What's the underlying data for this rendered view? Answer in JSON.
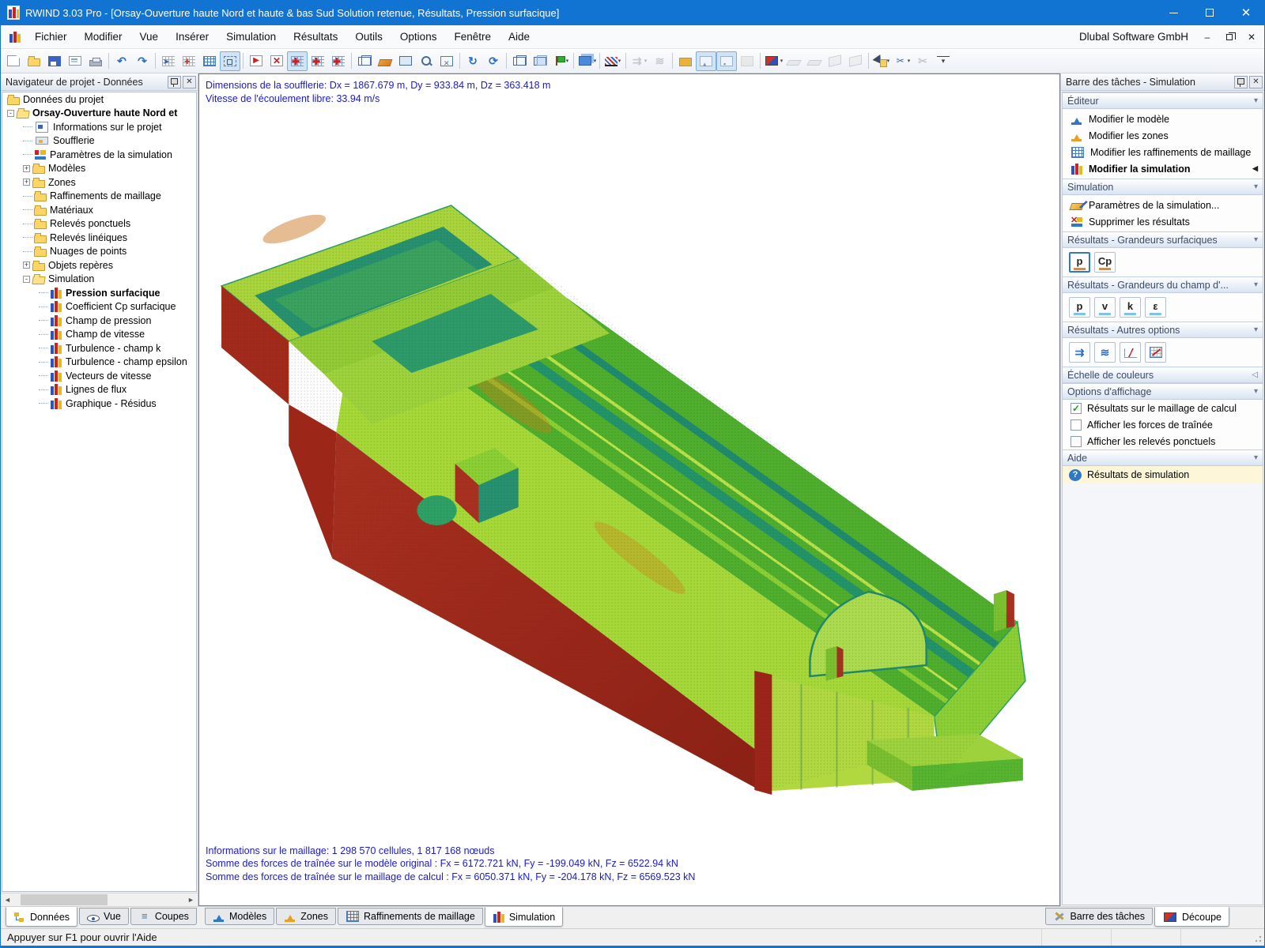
{
  "window": {
    "title": "RWIND 3.03 Pro - [Orsay-Ouverture haute Nord et haute & bas Sud Solution retenue, Résultats, Pression surfacique]"
  },
  "menu": {
    "items": [
      "Fichier",
      "Modifier",
      "Vue",
      "Insérer",
      "Simulation",
      "Résultats",
      "Outils",
      "Options",
      "Fenêtre",
      "Aide"
    ],
    "right_text": "Dlubal Software GmbH"
  },
  "toolbar": {
    "buttons": [
      {
        "name": "new-file",
        "icon": "page"
      },
      {
        "name": "open-file",
        "icon": "folder-open-tb"
      },
      {
        "name": "save",
        "icon": "floppy"
      },
      {
        "name": "print-preview",
        "icon": "preview"
      },
      {
        "name": "print",
        "icon": "printer"
      },
      {
        "sep": true
      },
      {
        "name": "undo",
        "icon": "undo"
      },
      {
        "name": "redo",
        "icon": "redo"
      },
      {
        "sep": true
      },
      {
        "name": "wind-zone",
        "icon": "wind"
      },
      {
        "name": "generate-mesh",
        "icon": "meshnode"
      },
      {
        "name": "mesh-nodes",
        "icon": "grid"
      },
      {
        "name": "mesh-region",
        "icon": "dottedbox",
        "state": "toggled"
      },
      {
        "sep": true
      },
      {
        "name": "run-simulation",
        "icon": "play"
      },
      {
        "name": "stop-simulation",
        "icon": "stopx"
      },
      {
        "name": "results-on-mesh",
        "icon": "axesmesh",
        "state": "toggled"
      },
      {
        "name": "results-on-model",
        "icon": "axesmesh"
      },
      {
        "name": "results-values",
        "icon": "axesmesh"
      },
      {
        "sep": true
      },
      {
        "name": "wireframe-view",
        "icon": "cubewire"
      },
      {
        "name": "rendered-view",
        "icon": "render"
      },
      {
        "name": "select-mode",
        "icon": "selectbox"
      },
      {
        "name": "zoom-window",
        "icon": "magnifier"
      },
      {
        "name": "zoom-fit",
        "icon": "fitview"
      },
      {
        "sep": true
      },
      {
        "name": "rotate-view",
        "icon": "rotate"
      },
      {
        "name": "refresh-view",
        "icon": "refresh"
      },
      {
        "sep": true
      },
      {
        "name": "isometric-view",
        "icon": "cubewire2"
      },
      {
        "name": "projection-mode",
        "icon": "cubeface"
      },
      {
        "name": "display-flags",
        "icon": "flag",
        "dropdown": true
      },
      {
        "sep": true
      },
      {
        "name": "solid-model",
        "icon": "cube3d",
        "dropdown": true
      },
      {
        "sep": true
      },
      {
        "name": "section-hatch",
        "icon": "hatch",
        "dropdown": true
      },
      {
        "sep": true
      },
      {
        "name": "flow-display",
        "icon": "flowarrows",
        "state": "disabled",
        "dropdown": true
      },
      {
        "name": "streamlines-display",
        "icon": "streams",
        "state": "disabled"
      },
      {
        "sep": true
      },
      {
        "name": "clip-new",
        "icon": "clipbox"
      },
      {
        "name": "clip-front",
        "icon": "clipa",
        "state": "toggled"
      },
      {
        "name": "clip-back",
        "icon": "clipb",
        "state": "toggled"
      },
      {
        "name": "clip-paste",
        "icon": "clippaste",
        "state": "disabled"
      },
      {
        "sep": true
      },
      {
        "name": "color-views",
        "icon": "cubergb",
        "dropdown": true
      },
      {
        "name": "clip-plane-a",
        "icon": "slab",
        "state": "disabled"
      },
      {
        "name": "clip-plane-b",
        "icon": "slab2",
        "state": "disabled"
      },
      {
        "name": "clip-plane-c",
        "icon": "plane",
        "state": "disabled"
      },
      {
        "name": "clip-plane-d",
        "icon": "plane2",
        "state": "disabled"
      },
      {
        "sep": true
      },
      {
        "name": "measure",
        "icon": "cursorflag",
        "dropdown": true
      },
      {
        "name": "cut-tools",
        "icon": "cutpen",
        "dropdown": true
      },
      {
        "name": "scissors",
        "icon": "scissors",
        "state": "disabled"
      },
      {
        "name": "toolbar-options",
        "icon": "overflow"
      }
    ]
  },
  "navigator": {
    "title": "Navigateur de projet - Données",
    "tree": [
      {
        "icon": "folder",
        "label": "Données du projet",
        "level": 0
      },
      {
        "icon": "folder-open",
        "label": "Orsay-Ouverture haute Nord et",
        "level": 0,
        "expand": "-",
        "bold": true
      },
      {
        "icon": "doc-info",
        "label": "Informations sur le projet",
        "level": 1
      },
      {
        "icon": "wind-tunnel",
        "label": "Soufflerie",
        "level": 1
      },
      {
        "icon": "sim-params",
        "label": "Paramètres de la simulation",
        "level": 1
      },
      {
        "icon": "folder",
        "label": "Modèles",
        "level": 1,
        "expand": "+"
      },
      {
        "icon": "folder",
        "label": "Zones",
        "level": 1,
        "expand": "+"
      },
      {
        "icon": "folder",
        "label": "Raffinements de maillage",
        "level": 1
      },
      {
        "icon": "folder",
        "label": "Matériaux",
        "level": 1
      },
      {
        "icon": "folder",
        "label": "Relevés ponctuels",
        "level": 1
      },
      {
        "icon": "folder",
        "label": "Relevés linéiques",
        "level": 1
      },
      {
        "icon": "folder",
        "label": "Nuages de points",
        "level": 1
      },
      {
        "icon": "folder",
        "label": "Objets repères",
        "level": 1,
        "expand": "+"
      },
      {
        "icon": "folder-open",
        "label": "Simulation",
        "level": 1,
        "expand": "-"
      },
      {
        "icon": "bars",
        "label": "Pression surfacique",
        "level": 2,
        "bold": true
      },
      {
        "icon": "bars",
        "label": "Coefficient Cp surfacique",
        "level": 2
      },
      {
        "icon": "bars",
        "label": "Champ de pression",
        "level": 2
      },
      {
        "icon": "bars",
        "label": "Champ de vitesse",
        "level": 2
      },
      {
        "icon": "bars",
        "label": "Turbulence - champ k",
        "level": 2
      },
      {
        "icon": "bars",
        "label": "Turbulence - champ epsilon",
        "level": 2
      },
      {
        "icon": "bars",
        "label": "Vecteurs de vitesse",
        "level": 2
      },
      {
        "icon": "bars",
        "label": "Lignes de flux",
        "level": 2
      },
      {
        "icon": "bars",
        "label": "Graphique - Résidus",
        "level": 2
      }
    ]
  },
  "viewport": {
    "info_top": [
      "Dimensions de la soufflerie: Dx = 1867.679 m, Dy = 933.84 m, Dz = 363.418 m",
      "Vitesse de l'écoulement libre: 33.94 m/s"
    ],
    "info_bottom": [
      "Informations sur le maillage: 1 298 570 cellules, 1 817 168 nœuds",
      "Somme des forces de traînée sur le modèle original : Fx = 6172.721 kN, Fy = -199.049 kN, Fz = 6522.94 kN",
      "Somme des forces de traînée sur le maillage de calcul : Fx = 6050.371 kN, Fy = -204.178 kN, Fz = 6569.523 kN"
    ]
  },
  "taskbar": {
    "title": "Barre des tâches - Simulation",
    "sections": [
      {
        "type": "items",
        "label": "Éditeur",
        "items": [
          {
            "icon": "stand-blue",
            "label": "Modifier le modèle"
          },
          {
            "icon": "stand-orange",
            "label": "Modifier les zones"
          },
          {
            "icon": "grid-blue",
            "label": "Modifier les raffinements de maillage"
          },
          {
            "icon": "bars",
            "label": "Modifier la simulation",
            "bold": true,
            "marker": "◀"
          }
        ]
      },
      {
        "type": "items",
        "label": "Simulation",
        "items": [
          {
            "icon": "palette",
            "label": "Paramètres de la simulation..."
          },
          {
            "icon": "delete",
            "label": "Supprimer les résultats"
          }
        ]
      },
      {
        "type": "buttons",
        "label": "Résultats - Grandeurs surfaciques",
        "underline": "#e8872a",
        "buttons": [
          {
            "label": "p",
            "selected": true
          },
          {
            "label": "Cp"
          }
        ]
      },
      {
        "type": "buttons",
        "label": "Résultats - Grandeurs du champ d'...",
        "underline": "#7ec3e8",
        "buttons": [
          {
            "label": "p"
          },
          {
            "label": "v"
          },
          {
            "label": "k"
          },
          {
            "label": "ε"
          }
        ]
      },
      {
        "type": "icon-buttons",
        "label": "Résultats - Autres options",
        "buttons": [
          {
            "icon": "flowarrows-blue",
            "name": "vectors-button"
          },
          {
            "icon": "streams-blue",
            "name": "streamlines-button"
          },
          {
            "icon": "graphline",
            "name": "graph-button"
          },
          {
            "icon": "residual",
            "name": "residuals-button"
          }
        ]
      },
      {
        "type": "header-only",
        "label": "Échelle de couleurs",
        "marker": "◁"
      },
      {
        "type": "checkboxes",
        "label": "Options d'affichage",
        "items": [
          {
            "label": "Résultats sur le maillage de calcul",
            "checked": true
          },
          {
            "label": "Afficher les forces de traînée",
            "checked": false
          },
          {
            "label": "Afficher les relevés ponctuels",
            "checked": false
          }
        ]
      },
      {
        "type": "help",
        "label": "Aide",
        "items": [
          {
            "icon": "help",
            "label": "Résultats de simulation"
          }
        ]
      }
    ]
  },
  "tabs": {
    "left": [
      {
        "icon": "tree-tab",
        "label": "Données",
        "active": true
      },
      {
        "icon": "eye",
        "label": "Vue"
      },
      {
        "icon": "layers",
        "label": "Coupes"
      }
    ],
    "center": [
      {
        "icon": "stand-blue",
        "label": "Modèles"
      },
      {
        "icon": "stand-orange",
        "label": "Zones"
      },
      {
        "icon": "grid-blue",
        "label": "Raffinements de maillage"
      },
      {
        "icon": "bars",
        "label": "Simulation",
        "active": true
      }
    ],
    "right": [
      {
        "icon": "tools",
        "label": "Barre des tâches"
      },
      {
        "icon": "cubergb",
        "label": "Découpe",
        "active": true
      }
    ]
  },
  "statusbar": {
    "text": "Appuyer sur F1 pour ouvrir l'Aide"
  },
  "colors": {
    "accent": "#1173d2",
    "info_text": "#1a1acd",
    "mesh_green": "#4fae2c",
    "mesh_yellow_green": "#a6d838",
    "mesh_red": "#9e2619",
    "mesh_teal": "#1f8a6e",
    "mesh_cyan": "#38cbd8",
    "help_bg": "#fdf6d8"
  }
}
